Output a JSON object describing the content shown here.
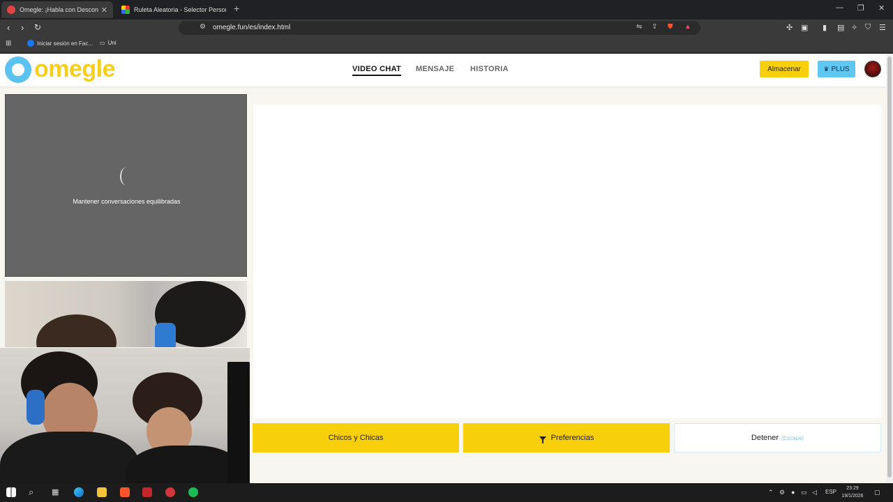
{
  "browser": {
    "tabs": [
      {
        "title": "Omegle: ¡Habla con Desconocidos!",
        "active": true
      },
      {
        "title": "Ruleta Aleatoria - Selector Personalizado",
        "active": false
      }
    ],
    "new_tab": "+",
    "url": "omegle.fun/es/index.html",
    "bookmarks": [
      {
        "label": "Iniciar sesión en Fac..."
      },
      {
        "label": "Uni"
      }
    ]
  },
  "site": {
    "logo_text": "omegle",
    "nav": [
      {
        "label": "VIDEO CHAT",
        "active": true
      },
      {
        "label": "MENSAJE",
        "active": false
      },
      {
        "label": "HISTORIA",
        "active": false
      }
    ],
    "store_button": "Almacenar",
    "plus_button": "PLUS",
    "plus_icon": "♛"
  },
  "stranger_panel": {
    "status_text": "Mantener conversaciones equilibradas"
  },
  "controls": {
    "gender_button": "Chicos y Chicas",
    "preferences_button": "Preferencias",
    "stop_button": "Detener",
    "stop_hint": "(Escape)"
  },
  "taskbar": {
    "language": "ESP",
    "time": "23:29",
    "date": "19/1/2026"
  },
  "colors": {
    "accent_yellow": "#f7cf0a",
    "accent_blue": "#5ec8f2",
    "page_background": "#f8f6f1"
  }
}
